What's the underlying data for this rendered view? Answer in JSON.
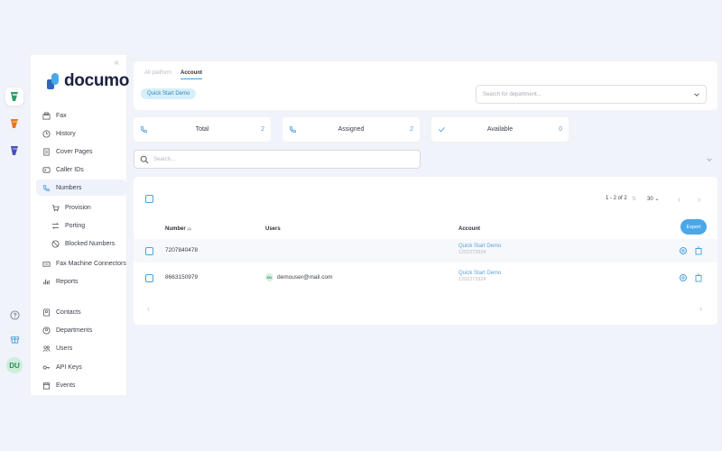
{
  "sidebar": {
    "logo_text": "documo",
    "items": [
      {
        "label": "Fax"
      },
      {
        "label": "History"
      },
      {
        "label": "Cover Pages"
      },
      {
        "label": "Caller IDs"
      },
      {
        "label": "Numbers"
      },
      {
        "label": "Provision"
      },
      {
        "label": "Porting"
      },
      {
        "label": "Blocked Numbers"
      },
      {
        "label": "Fax Machine Connectors"
      },
      {
        "label": "Reports"
      },
      {
        "label": "Contacts"
      },
      {
        "label": "Departments"
      },
      {
        "label": "Users"
      },
      {
        "label": "API Keys"
      },
      {
        "label": "Events"
      }
    ]
  },
  "rail": {
    "avatar_initials": "DU",
    "colors": {
      "app1": "#2f9a6a",
      "app2": "#e8742b",
      "app3": "#4a4fb8"
    }
  },
  "header": {
    "tabs": [
      {
        "label": "All platform"
      },
      {
        "label": "Account"
      }
    ],
    "chip": "Quick Start Demo",
    "department_placeholder": "Search for department..."
  },
  "stats": [
    {
      "label": "Total",
      "count": "2"
    },
    {
      "label": "Assigned",
      "count": "2"
    },
    {
      "label": "Available",
      "count": "0"
    }
  ],
  "search": {
    "placeholder": "Search..."
  },
  "table": {
    "pager": {
      "range": "1 - 2 of 2",
      "per_page": "30"
    },
    "columns": {
      "number": "Number",
      "users": "Users",
      "account": "Account"
    },
    "export_label": "Export",
    "rows": [
      {
        "number": "7207840478",
        "user": "",
        "user_initials": "",
        "account_name": "Quick Start Demo",
        "account_id": "1202272924"
      },
      {
        "number": "8663150979",
        "user": "demouser@mail.com",
        "user_initials": "DU",
        "account_name": "Quick Start Demo",
        "account_id": "1202272924"
      }
    ]
  },
  "colors": {
    "accent": "#4aa0d6",
    "background": "#f1f3fa"
  }
}
